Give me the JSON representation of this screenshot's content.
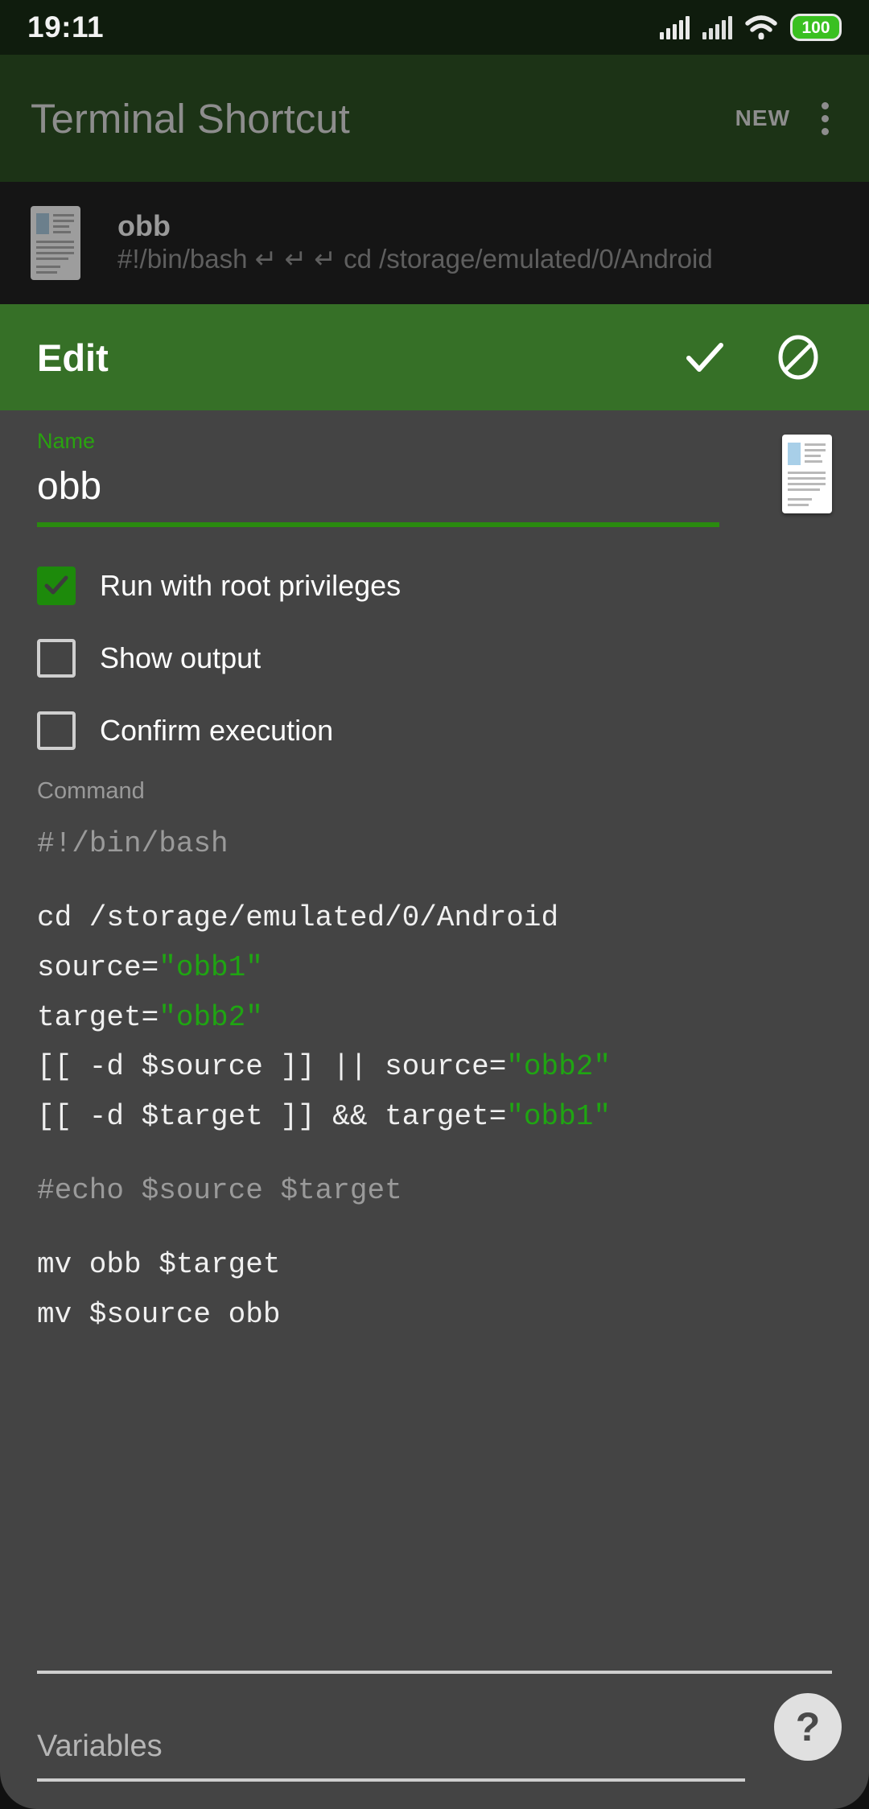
{
  "status_bar": {
    "time": "19:11",
    "battery_level": "100",
    "icons": [
      "signal-bars-icon",
      "signal-bars-icon",
      "wifi-icon",
      "battery-icon"
    ]
  },
  "app_bar": {
    "title": "Terminal Shortcut",
    "new_label": "NEW",
    "overflow_icon": "kebab-menu-icon"
  },
  "background_list": {
    "items": [
      {
        "icon": "document-icon",
        "title": "obb",
        "subtitle": "#!/bin/bash ↵    ↵    ↵  cd /storage/emulated/0/Android"
      }
    ]
  },
  "dialog": {
    "title": "Edit",
    "confirm_icon": "check-icon",
    "cancel_icon": "block-circle-icon",
    "name": {
      "label": "Name",
      "value": "obb",
      "icon": "document-icon"
    },
    "options": [
      {
        "label": "Run with root privileges",
        "checked": true
      },
      {
        "label": "Show output",
        "checked": false
      },
      {
        "label": "Confirm execution",
        "checked": false
      }
    ],
    "command": {
      "label": "Command",
      "lines": [
        {
          "segments": [
            {
              "text": "#!/bin/bash",
              "style": "comment"
            }
          ]
        },
        {
          "segments": [
            {
              "text": "",
              "style": "plain"
            }
          ]
        },
        {
          "segments": [
            {
              "text": "cd /storage/emulated/0/Android",
              "style": "plain"
            }
          ]
        },
        {
          "segments": [
            {
              "text": "source=",
              "style": "plain"
            },
            {
              "text": "\"obb1\"",
              "style": "string"
            }
          ]
        },
        {
          "segments": [
            {
              "text": "target=",
              "style": "plain"
            },
            {
              "text": "\"obb2\"",
              "style": "string"
            }
          ]
        },
        {
          "segments": [
            {
              "text": "[[ -d $source ]] || source=",
              "style": "plain"
            },
            {
              "text": "\"obb2\"",
              "style": "string"
            }
          ]
        },
        {
          "segments": [
            {
              "text": "[[ -d $target ]] && target=",
              "style": "plain"
            },
            {
              "text": "\"obb1\"",
              "style": "string"
            }
          ]
        },
        {
          "segments": [
            {
              "text": "",
              "style": "plain"
            }
          ]
        },
        {
          "segments": [
            {
              "text": "#echo $source $target",
              "style": "comment"
            }
          ]
        },
        {
          "segments": [
            {
              "text": "",
              "style": "plain"
            }
          ]
        },
        {
          "segments": [
            {
              "text": "mv obb $target",
              "style": "plain"
            }
          ]
        },
        {
          "segments": [
            {
              "text": "mv $source obb",
              "style": "plain"
            }
          ]
        }
      ]
    },
    "variables": {
      "placeholder": "Variables"
    },
    "help_button": {
      "icon": "help-question-icon",
      "label": "?"
    }
  },
  "colors": {
    "accent_green": "#2a8a0f",
    "header_green": "#367027",
    "dialog_bg": "#444444",
    "string_green": "#1fa512",
    "battery_green": "#3ac021"
  }
}
